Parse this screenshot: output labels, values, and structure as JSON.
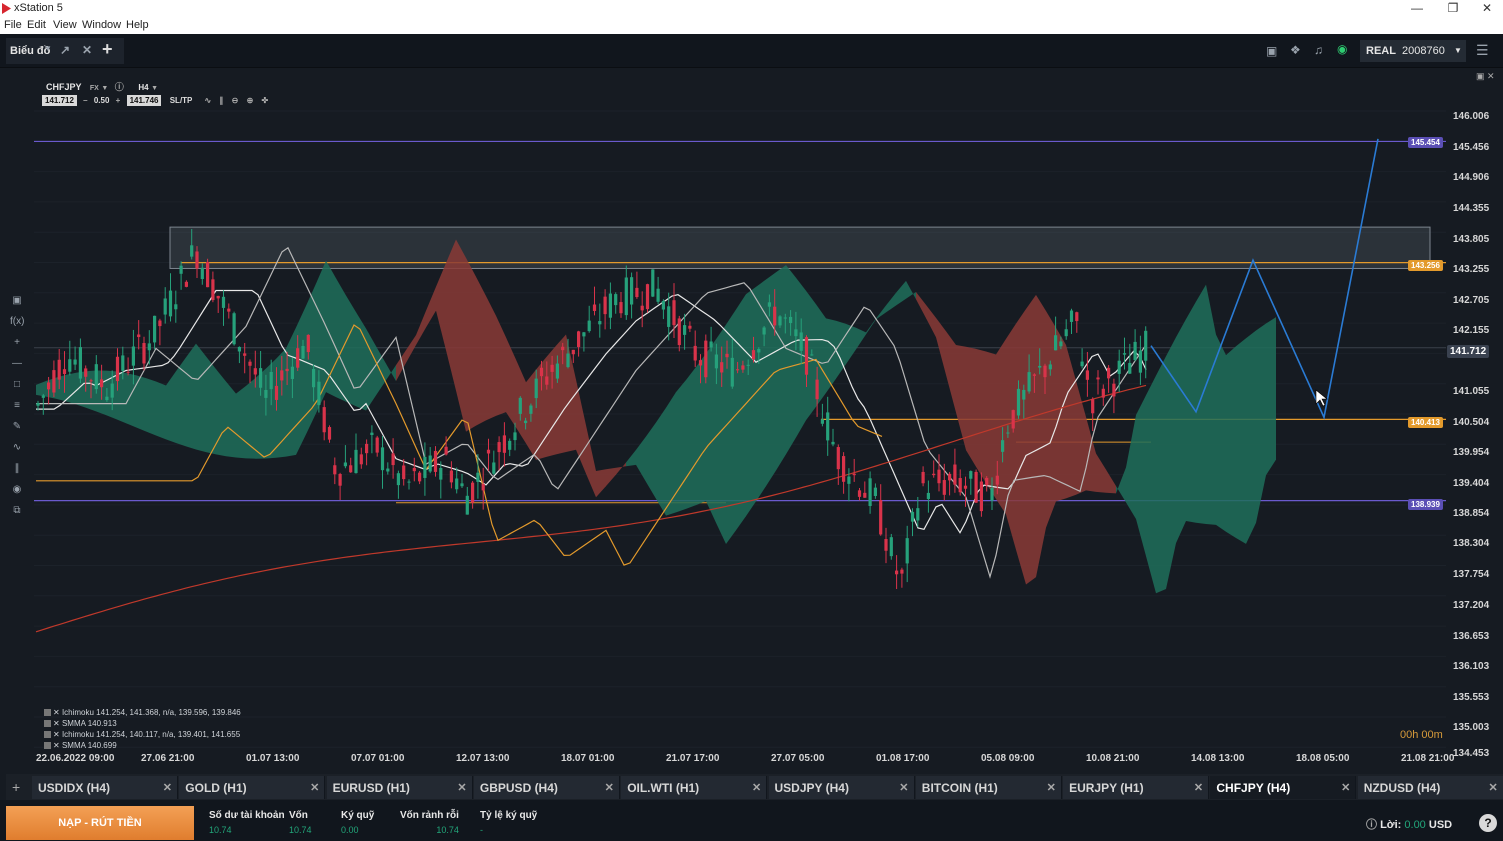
{
  "window": {
    "title": "xStation 5"
  },
  "menu": [
    "File",
    "Edit",
    "View",
    "Window",
    "Help"
  ],
  "toolbar": {
    "chart_tab": "Biểu đồ",
    "account_type": "REAL",
    "account_number": "2008760"
  },
  "chart": {
    "symbol": "CHFJPY",
    "market": "FX",
    "timeframe": "H4",
    "bid": "141.712",
    "spread": "0.50",
    "ask": "141.746",
    "sltp": "SL/TP",
    "timer": "00h 00m",
    "price_axis": [
      "146.006",
      "145.456",
      "144.906",
      "144.355",
      "143.805",
      "143.255",
      "142.705",
      "142.155",
      "141.712",
      "141.055",
      "140.504",
      "139.954",
      "139.404",
      "138.854",
      "138.304",
      "137.754",
      "137.204",
      "136.653",
      "136.103",
      "135.553",
      "135.003",
      "134.453"
    ],
    "time_axis": [
      "22.06.2022 09:00",
      "27.06 21:00",
      "01.07 13:00",
      "07.07 01:00",
      "12.07 13:00",
      "18.07 01:00",
      "21.07 17:00",
      "27.07 05:00",
      "01.08 17:00",
      "05.08 09:00",
      "10.08 21:00",
      "14.08 13:00",
      "18.08 05:00",
      "21.08 21:00"
    ],
    "tags": {
      "top_line": "145.454",
      "resistance": "143.256",
      "current": "141.712",
      "support": "140.413",
      "bottom_line": "138.939"
    },
    "indicators": [
      "Ichimoku 141.254, 141.368, n/a, 139.596, 139.846",
      "SMMA 140.913",
      "Ichimoku 141.254, 140.117, n/a, 139.401, 141.655",
      "SMMA 140.699"
    ],
    "colors": {
      "bull": "#26a17b",
      "bear": "#d9334a",
      "cloud_bull": "#1f6e5a",
      "cloud_bear": "#8a3a36",
      "orange": "#e39a2c",
      "purple": "#6a5acd",
      "forecast": "#2a7bd4"
    }
  },
  "tabs": [
    {
      "label": "USDIDX (H4)",
      "active": false
    },
    {
      "label": "GOLD (H1)",
      "active": false
    },
    {
      "label": "EURUSD (H1)",
      "active": false
    },
    {
      "label": "GBPUSD (H4)",
      "active": false
    },
    {
      "label": "OIL.WTI (H1)",
      "active": false
    },
    {
      "label": "USDJPY (H4)",
      "active": false
    },
    {
      "label": "BITCOIN (H1)",
      "active": false
    },
    {
      "label": "EURJPY (H1)",
      "active": false
    },
    {
      "label": "CHFJPY (H4)",
      "active": true
    },
    {
      "label": "NZDUSD (H4)",
      "active": false
    }
  ],
  "account": {
    "deposit_button": "NẠP - RÚT TIỀN",
    "balance_label": "Số dư tài khoản",
    "balance": "10.74",
    "equity_label": "Vốn",
    "equity": "10.74",
    "margin_label": "Ký quỹ",
    "margin": "0.00",
    "free_margin_label": "Vốn rảnh rỗi",
    "free_margin": "10.74",
    "margin_level_label": "Tỷ lệ ký quỹ",
    "margin_level": "-",
    "profit_label": "Lời:",
    "profit": "0.00",
    "currency": "USD"
  }
}
